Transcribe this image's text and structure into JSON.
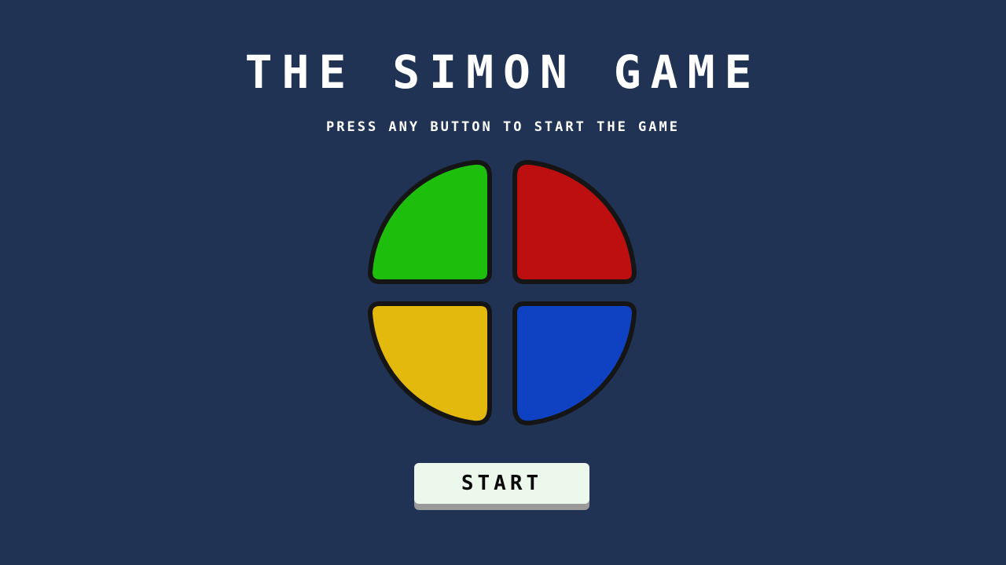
{
  "game": {
    "title": "THE SIMON GAME",
    "subtitle": "PRESS ANY BUTTON TO START THE GAME",
    "start_label": "START"
  },
  "pads": [
    {
      "name": "green",
      "color": "#1ebe0c"
    },
    {
      "name": "red",
      "color": "#bd0f0f"
    },
    {
      "name": "yellow",
      "color": "#e4b90e"
    },
    {
      "name": "blue",
      "color": "#0f42c3"
    }
  ],
  "colors": {
    "background": "#203354",
    "outline": "#151515",
    "button_face": "#ecf8ec",
    "button_shadow": "#9a9a9a"
  }
}
